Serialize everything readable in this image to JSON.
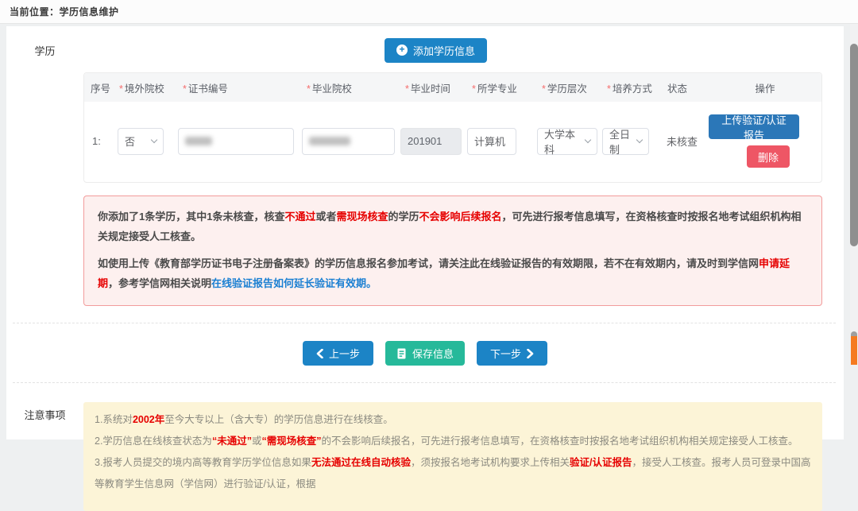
{
  "colors": {
    "primary_blue": "#1c84c6",
    "upload_blue": "#2b77b8",
    "delete_red": "#ee5665",
    "save_green": "#26b99a",
    "alert_red": "#e60000",
    "link_blue": "#1a7fd2",
    "required_star_red": "#f56c6c",
    "notice_bg": "#fdf0ef",
    "notice_border": "#f29c9c",
    "notes_bg": "#fcf4d7"
  },
  "breadcrumb": "当前位置：学历信息维护",
  "education": {
    "label": "学历",
    "add_button": "添加学历信息",
    "table": {
      "headers": [
        {
          "star": "",
          "label": "序号"
        },
        {
          "star": "*",
          "label": "境外院校"
        },
        {
          "star": "*",
          "label": "证书编号"
        },
        {
          "star": "*",
          "label": "毕业院校"
        },
        {
          "star": "*",
          "label": "毕业时间"
        },
        {
          "star": "*",
          "label": "所学专业"
        },
        {
          "star": "*",
          "label": "学历层次"
        },
        {
          "star": "*",
          "label": "培养方式"
        },
        {
          "star": "",
          "label": "状态"
        },
        {
          "star": "",
          "label": "操作"
        }
      ],
      "row": {
        "index": "1:",
        "overseas_value": "否",
        "certificate_masked": true,
        "school_masked": true,
        "graduation_time": "201901",
        "major": "计算机",
        "level": "大学本科",
        "mode": "全日制",
        "status": "未核查",
        "upload_button": "上传验证/认证报告",
        "delete_button": "删除"
      }
    },
    "notice": {
      "p1": [
        {
          "t": "你添加了1条学历，其中1条未核查，核查"
        },
        {
          "t": "不通过",
          "s": "red"
        },
        {
          "t": "或者"
        },
        {
          "t": "需现场核查",
          "s": "red"
        },
        {
          "t": "的学历"
        },
        {
          "t": "不会影响后续报名",
          "s": "red"
        },
        {
          "t": "，可先进行报考信息填写，在资格核查时按报名地考试组织机构相关规定接受人工核查。"
        }
      ],
      "p2": [
        {
          "t": "如使用上传《教育部学历证书电子注册备案表》的学历信息报名参加考试，请关注此在线验证报告的有效期限，若不在有效期内，请及时到学信网"
        },
        {
          "t": "申请延期",
          "s": "red"
        },
        {
          "t": "，参考学信网相关说明"
        },
        {
          "t": "在线验证报告如何延长验证有效期。",
          "s": "link"
        }
      ]
    }
  },
  "actions": {
    "prev": "上一步",
    "save": "保存信息",
    "next": "下一步"
  },
  "notes": {
    "label": "注意事项",
    "items": [
      [
        {
          "t": "1.系统对"
        },
        {
          "t": "2002年",
          "s": "red"
        },
        {
          "t": "至今大专以上（含大专）的学历信息进行在线核查。"
        }
      ],
      [
        {
          "t": "2.学历信息在线核查状态为"
        },
        {
          "t": "“未通过”",
          "s": "red"
        },
        {
          "t": "或"
        },
        {
          "t": "“需现场核查”",
          "s": "red"
        },
        {
          "t": "的不会影响后续报名，可先进行报考信息填写，在资格核查时按报名地考试组织机构相关规定接受人工核查。"
        }
      ],
      [
        {
          "t": "3.报考人员提交的境内高等教育学历学位信息如果"
        },
        {
          "t": "无法通过在线自动核验",
          "s": "red"
        },
        {
          "t": "，须按报名地考试机构要求上传相关"
        },
        {
          "t": "验证/认证报告",
          "s": "red"
        },
        {
          "t": "，接受人工核查。报考人员可登录中国高等教育学生信息网（学信网）进行验证/认证，根据"
        }
      ]
    ]
  }
}
